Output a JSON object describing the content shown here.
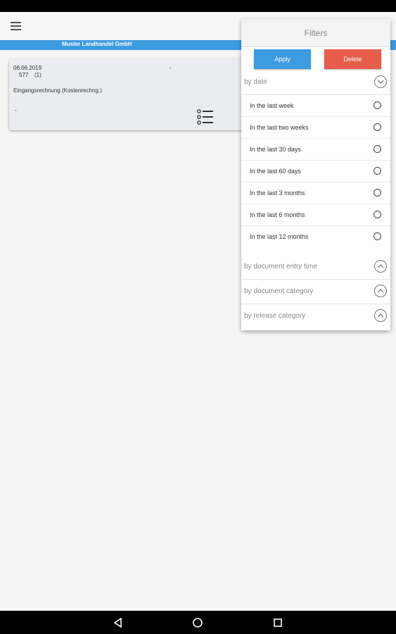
{
  "company": {
    "name": "Muster Landhandel GmbH"
  },
  "document": {
    "date": "06.06.2019",
    "number": "577",
    "count": "(1)",
    "dash_top": "-",
    "type": "Eingangsrechnung (Kostenrechng.)",
    "dash_bottom": "-"
  },
  "filters": {
    "title": "Filters",
    "apply_label": "Apply",
    "delete_label": "Delete",
    "by_date": {
      "label": "by date",
      "options": [
        "In the last week",
        "In the last two weeks",
        "In the last 30 days",
        "In the last 60 days",
        "In the last 3 months",
        "In the last 6 months",
        "In the last 12 months"
      ]
    },
    "by_entry_time": "by document entry time",
    "by_category": "by document category",
    "by_release": "by release category"
  },
  "colors": {
    "accent": "#3d9be0",
    "delete": "#e85c4a"
  }
}
